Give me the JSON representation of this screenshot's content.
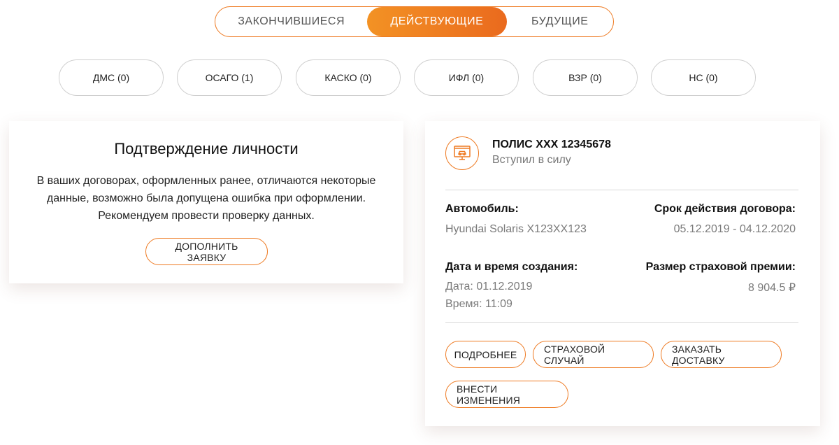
{
  "status_tabs": [
    {
      "label": "ЗАКОНЧИВШИЕСЯ",
      "active": false
    },
    {
      "label": "ДЕЙСТВУЮЩИЕ",
      "active": true
    },
    {
      "label": "БУДУЩИЕ",
      "active": false
    }
  ],
  "categories": [
    {
      "label": "ДМС (0)"
    },
    {
      "label": "ОСАГО (1)"
    },
    {
      "label": "КАСКО (0)"
    },
    {
      "label": "ИФЛ (0)"
    },
    {
      "label": "ВЗР (0)"
    },
    {
      "label": "НС (0)"
    }
  ],
  "identity": {
    "title": "Подтверждение личности",
    "text": "В ваших договорах, оформленных ранее, отличаются некоторые данные, возможно была допущена ошибка при оформлении. Рекомендуем провести проверку данных.",
    "button": "ДОПОЛНИТЬ ЗАЯВКУ"
  },
  "policy": {
    "icon": "car-policy-icon",
    "title": "ПОЛИС ХХХ 12345678",
    "status": "Вступил в силу",
    "car_label": "Автомобиль:",
    "car_value": "Hyundai Solaris Х123ХХ123",
    "term_label": "Срок действия договора:",
    "term_value": "05.12.2019 - 04.12.2020",
    "created_label": "Дата и время создания:",
    "created_date": "Дата: 01.12.2019",
    "created_time": "Время: 11:09",
    "premium_label": "Размер страховой премии:",
    "premium_value": "8 904.5 ₽",
    "buttons": {
      "details": "ПОДРОБНЕЕ",
      "claim": "СТРАХОВОЙ СЛУЧАЙ",
      "delivery": "ЗАКАЗАТЬ ДОСТАВКУ",
      "changes": "ВНЕСТИ ИЗМЕНЕНИЯ"
    }
  },
  "colors": {
    "accent": "#ee7a22",
    "accent_gradient_start": "#f39224",
    "accent_gradient_end": "#ea6a1e"
  }
}
